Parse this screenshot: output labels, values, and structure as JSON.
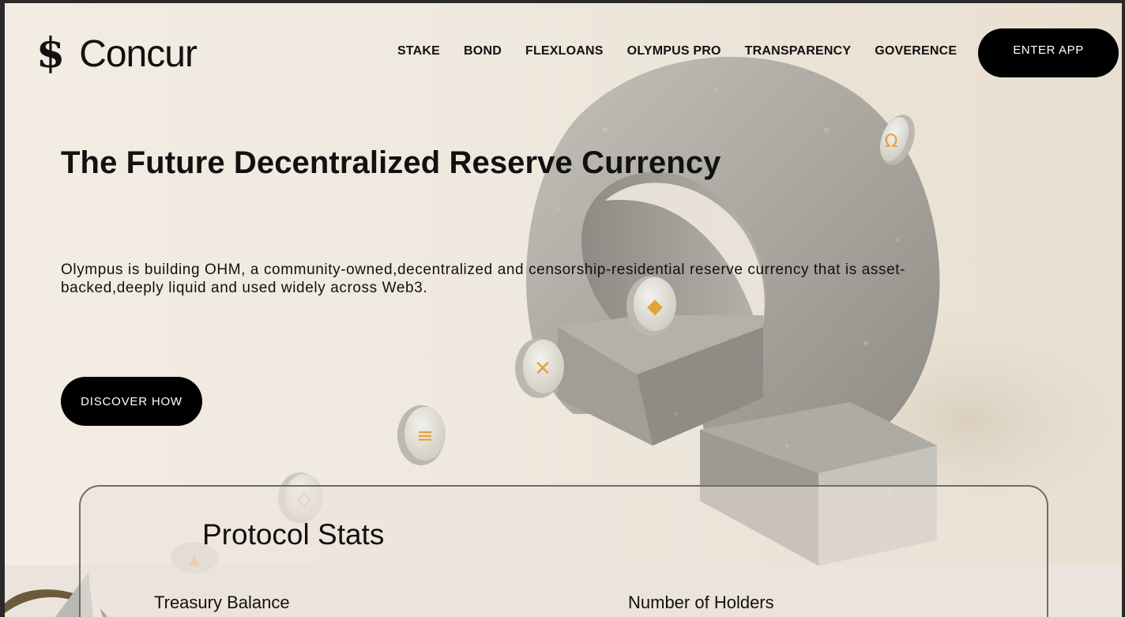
{
  "brand": {
    "icon": "$",
    "icon_name": "dollar-icon",
    "name": "Concur"
  },
  "nav": {
    "items": [
      {
        "label": "STAKE"
      },
      {
        "label": "BOND"
      },
      {
        "label": "FLEXLOANS"
      },
      {
        "label": "OLYMPUS PRO"
      },
      {
        "label": "TRANSPARENCY"
      },
      {
        "label": "GOVERENCE"
      }
    ],
    "enter_label": "ENTER APP"
  },
  "hero": {
    "title": "The Future Decentralized Reserve Currency",
    "description": "Olympus is building OHM, a community-owned,decentralized and censorship-residential reserve currency that is asset-backed,deeply liquid and used widely across Web3.",
    "cta_label": "DISCOVER HOW"
  },
  "stats": {
    "title": "Protocol Stats",
    "labels": {
      "treasury": "Treasury Balance",
      "holders": "Number of Holders"
    }
  },
  "colors": {
    "background": "#f1ebe2",
    "button": "#000000",
    "coin_symbol": "#e0a43a",
    "stone": "#a7a49e"
  }
}
